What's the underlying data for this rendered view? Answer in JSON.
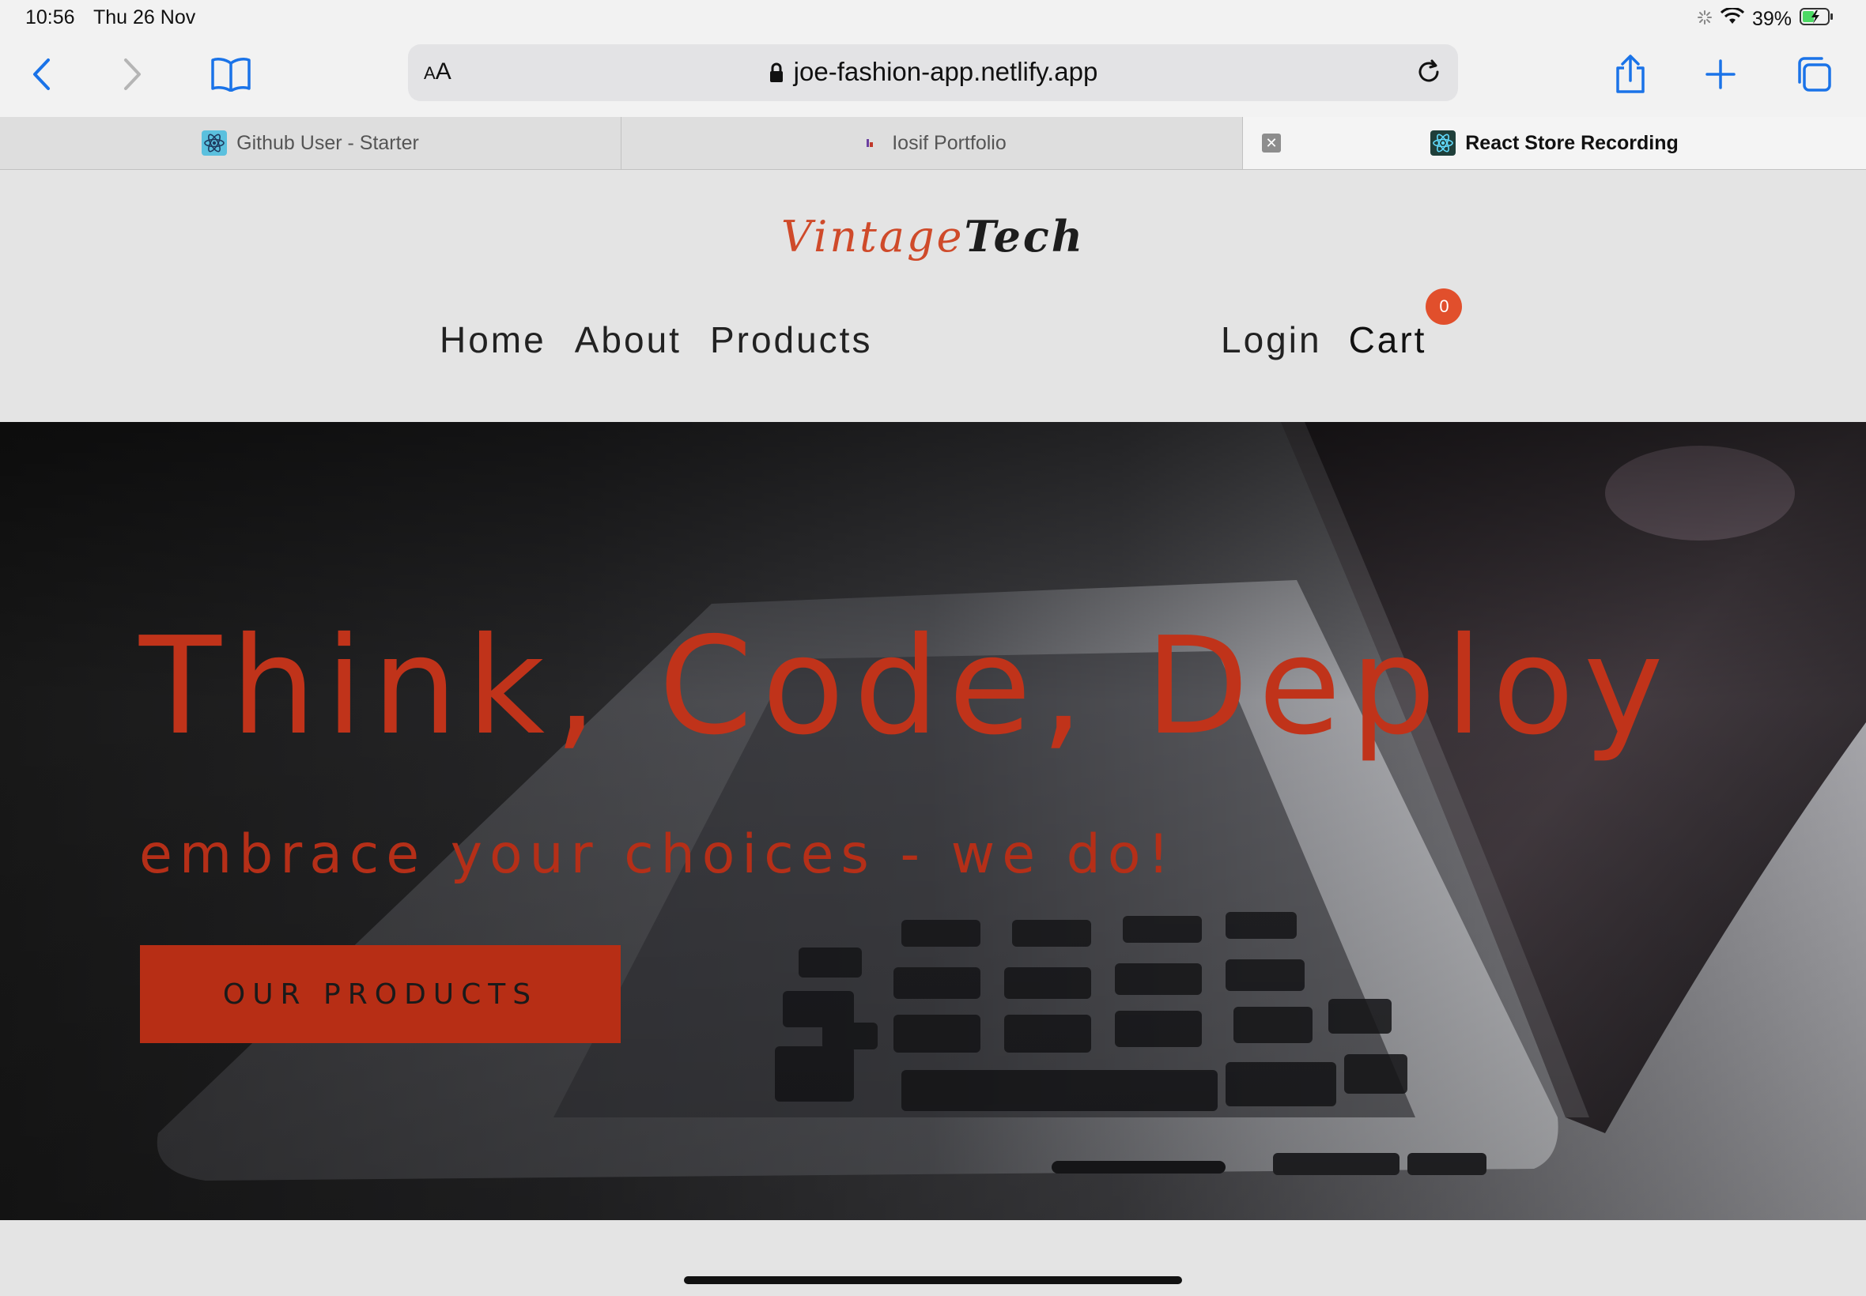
{
  "status_bar": {
    "time": "10:56",
    "date": "Thu 26 Nov",
    "battery": "39%"
  },
  "browser": {
    "reader_label": "AA",
    "url": "joe-fashion-app.netlify.app",
    "tabs": [
      {
        "label": "Github User - Starter",
        "favicon": "react-icon"
      },
      {
        "label": "Iosif Portfolio",
        "favicon": "portfolio-icon"
      },
      {
        "label": "React Store Recording",
        "favicon": "react-icon",
        "active": true
      }
    ]
  },
  "site": {
    "logo": {
      "part1": "Vintage",
      "part2": "Tech"
    },
    "nav_left": [
      "Home",
      "About",
      "Products"
    ],
    "nav_login": "Login",
    "nav_cart": "Cart",
    "cart_count": "0"
  },
  "hero": {
    "title": "Think, Code, Deploy",
    "subtitle": "embrace your choices - we do!",
    "button": "OUR PRODUCTS"
  },
  "colors": {
    "accent": "#c0331a",
    "badge": "#e14f2c",
    "ios_blue": "#1a73e8"
  }
}
